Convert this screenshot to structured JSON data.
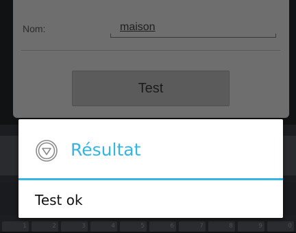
{
  "form": {
    "name_label": "Nom:",
    "name_value": "maison",
    "test_button": "Test"
  },
  "dialog": {
    "title": "Résultat",
    "icon": "circle-down-triangle-icon",
    "message": "Test ok"
  },
  "keyboard": {
    "number_keys": [
      "1",
      "2",
      "3",
      "4",
      "5",
      "6",
      "7",
      "8",
      "9",
      "0"
    ]
  },
  "colors": {
    "accent": "#33b5e5"
  }
}
